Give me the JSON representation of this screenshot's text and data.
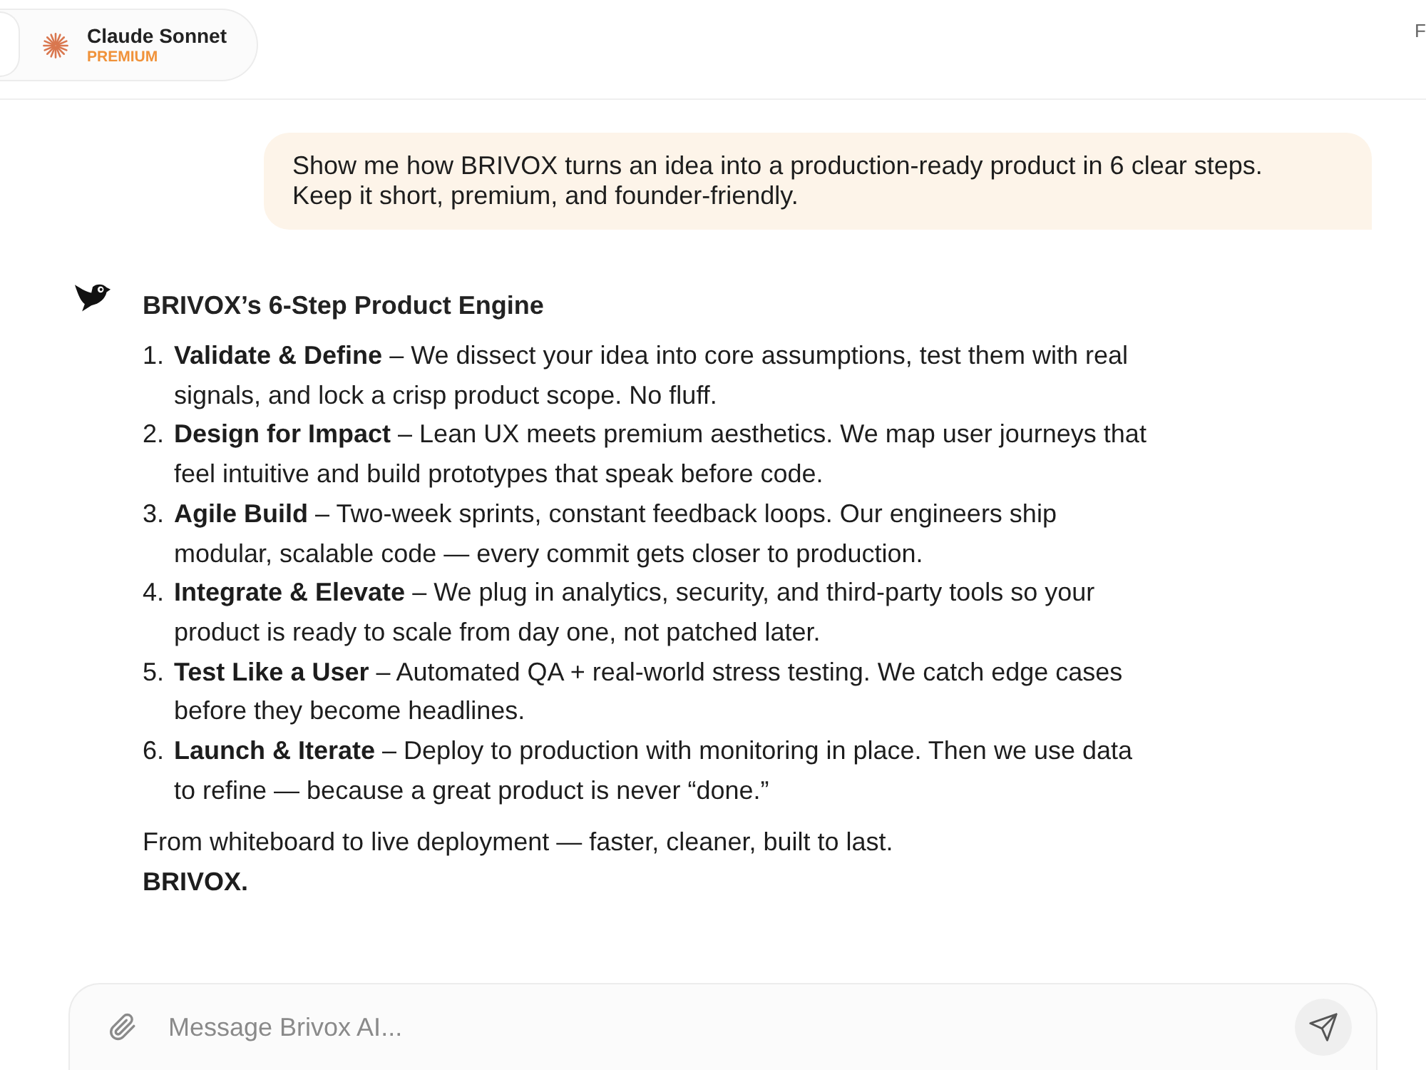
{
  "header": {
    "model": {
      "name": "Claude Sonnet",
      "tier": "PREMIUM"
    },
    "edge_label": "F"
  },
  "messages": [
    {
      "kind": "user",
      "text": "Show me how BRIVOX turns an idea into a production-ready product in 6 clear steps. Keep it short, premium, and founder-friendly."
    },
    {
      "kind": "assistant",
      "title": "BRIVOX’s 6-Step Product Engine",
      "steps": [
        {
          "number": "1.",
          "text": "**Validate & Define** – We dissect your idea into core assumptions, test them with real signals, and lock a crisp product scope. No fluff."
        },
        {
          "number": "2.",
          "text": "**Design for Impact** – Lean UX meets premium aesthetics. We map user journeys that feel intuitive and build prototypes that speak before code."
        },
        {
          "number": "3.",
          "text": "**Agile Build** – Two-week sprints, constant feedback loops. Our engineers ship modular, scalable code — every commit gets closer to production."
        },
        {
          "number": "4.",
          "text": "**Integrate & Elevate** – We plug in analytics, security, and third-party tools so your product is ready to scale from day one, not patched later."
        },
        {
          "number": "5.",
          "text": "**Test Like a User** – Automated QA + real-world stress testing. We catch edge cases before they become headlines."
        },
        {
          "number": "6.",
          "text": "**Launch & Iterate** – Deploy to production with monitoring in place. Then we use data to refine — because a great product is never “done.”"
        }
      ],
      "closing": "From whiteboard to live deployment — faster, cleaner, built to last.",
      "signature": "BRIVOX."
    }
  ],
  "composer": {
    "placeholder": "Message Brivox AI..."
  }
}
